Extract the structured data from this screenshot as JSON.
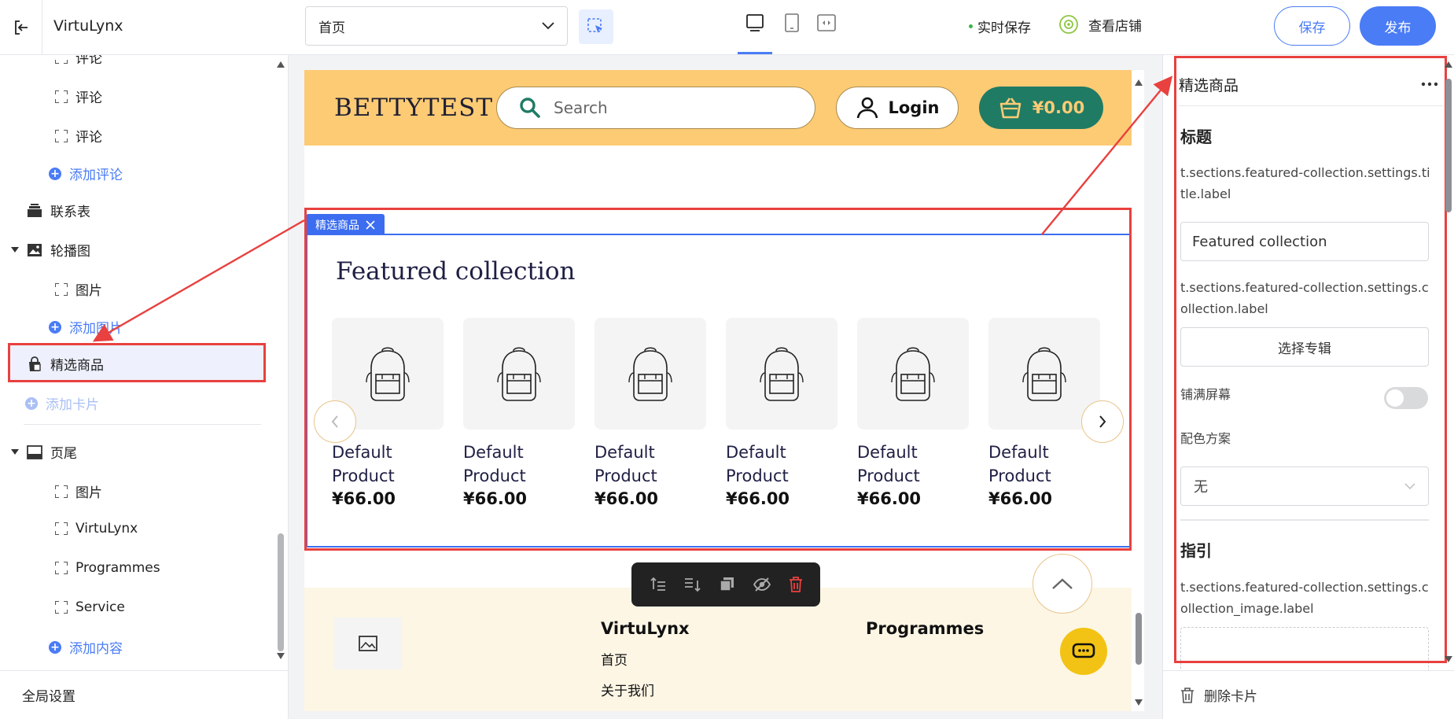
{
  "topbar": {
    "store_name": "VirtuLynx",
    "page_select": "首页",
    "autosave": "实时保存",
    "view_store": "查看店铺",
    "save": "保存",
    "publish": "发布",
    "colors": {
      "accent": "#4a7cf6",
      "autosave_dot": "#3ab54a",
      "view_icon": "#8cc63f"
    }
  },
  "left_panel": {
    "items": [
      {
        "label": "评论",
        "type": "block"
      },
      {
        "label": "评论",
        "type": "block"
      },
      {
        "label": "评论",
        "type": "block"
      },
      {
        "label": "添加评论",
        "type": "add"
      },
      {
        "label": "联系表",
        "type": "section"
      },
      {
        "label": "轮播图",
        "type": "section-expanded"
      },
      {
        "label": "图片",
        "type": "block"
      },
      {
        "label": "添加图片",
        "type": "add"
      },
      {
        "label": "精选商品",
        "type": "section-selected"
      },
      {
        "label": "添加卡片",
        "type": "add-disabled"
      },
      {
        "label": "页尾",
        "type": "section-expanded"
      },
      {
        "label": "图片",
        "type": "block"
      },
      {
        "label": "VirtuLynx",
        "type": "block"
      },
      {
        "label": "Programmes",
        "type": "block"
      },
      {
        "label": "Service",
        "type": "block"
      },
      {
        "label": "添加内容",
        "type": "add"
      }
    ],
    "global_settings": "全局设置"
  },
  "canvas": {
    "header": {
      "logo": "BETTYTEST",
      "search_placeholder": "Search",
      "login": "Login",
      "cart_total": "¥0.00",
      "colors": {
        "bg": "#fdcb74",
        "cart": "#207b65"
      }
    },
    "section_tag": "精选商品",
    "featured": {
      "title": "Featured collection",
      "products": [
        {
          "name": "Default Product",
          "price": "¥66.00"
        },
        {
          "name": "Default Product",
          "price": "¥66.00"
        },
        {
          "name": "Default Product",
          "price": "¥66.00"
        },
        {
          "name": "Default Product",
          "price": "¥66.00"
        },
        {
          "name": "Default Product",
          "price": "¥66.00"
        },
        {
          "name": "Default Product",
          "price": "¥66.00"
        }
      ]
    },
    "footer": {
      "columns": [
        {
          "title": "VirtuLynx",
          "links": [
            "首页",
            "关于我们"
          ]
        },
        {
          "title": "Programmes",
          "links": []
        }
      ]
    }
  },
  "right_panel": {
    "title": "精选商品",
    "heading_title": "标题",
    "title_label": "t.sections.featured-collection.settings.title.label",
    "title_value": "Featured collection",
    "collection_label": "t.sections.featured-collection.settings.collection.label",
    "select_collection": "选择专辑",
    "full_width": "铺满屏幕",
    "full_width_on": false,
    "color_scheme": "配色方案",
    "color_scheme_value": "无",
    "heading_guide": "指引",
    "collection_image_label": "t.sections.featured-collection.settings.collection_image.label",
    "delete_card": "删除卡片"
  }
}
